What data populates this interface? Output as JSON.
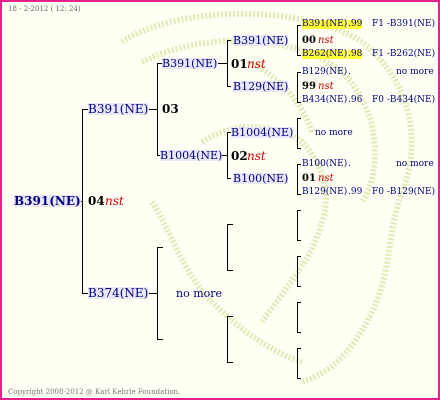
{
  "header": {
    "date": "18 - 2-2012 ( 12: 24)"
  },
  "footer": {
    "copyright": "Copyright 2008-2012 @ Karl Kehrle Foundation."
  },
  "root": {
    "name": "B391(NE)"
  },
  "gen1": {
    "top": {
      "name": "B391(NE)",
      "num": "03"
    },
    "mid": {
      "num": "04",
      "tag": "nst"
    },
    "bottom": {
      "name": "B374(NE)",
      "more": "no more"
    }
  },
  "gen2": {
    "a": {
      "name": "B391(NE)",
      "num": "01",
      "tag": "nst"
    },
    "b": {
      "name": "B1004(NE)",
      "num": "02",
      "tag": "nst"
    }
  },
  "gen3": {
    "a1": {
      "name": "B391(NE)",
      "num": "00",
      "tag": "nst"
    },
    "a2": {
      "name": "B129(NE)",
      "num": "99",
      "tag": "nst"
    },
    "b1": {
      "name": "B1004(NE)",
      "more": "no more"
    },
    "b2": {
      "name": "B100(NE)",
      "num": "01",
      "tag": "nst"
    }
  },
  "gen4": {
    "r1": {
      "name": "B391(NE)",
      "pct": ".99",
      "ref": "F1 -B391(NE)"
    },
    "r2": {
      "name": "B262(NE)",
      "pct": ".98",
      "ref": "F1 -B262(NE)"
    },
    "r3": {
      "name": "B129(NE)",
      "dot": ".",
      "more": "no more"
    },
    "r4": {
      "name": "B434(NE)",
      "pct": ".96",
      "ref": "F0 -B434(NE)"
    },
    "r5": {
      "name": "B100(NE)",
      "dot": ".",
      "more": "no more"
    },
    "r6": {
      "name": "B129(NE)",
      "pct": ".99",
      "ref": "F0 -B129(NE)"
    }
  },
  "colors": {
    "border": "#e6208c",
    "highlight": "#ffff33",
    "name": "#000080",
    "nst": "#cc0000"
  }
}
